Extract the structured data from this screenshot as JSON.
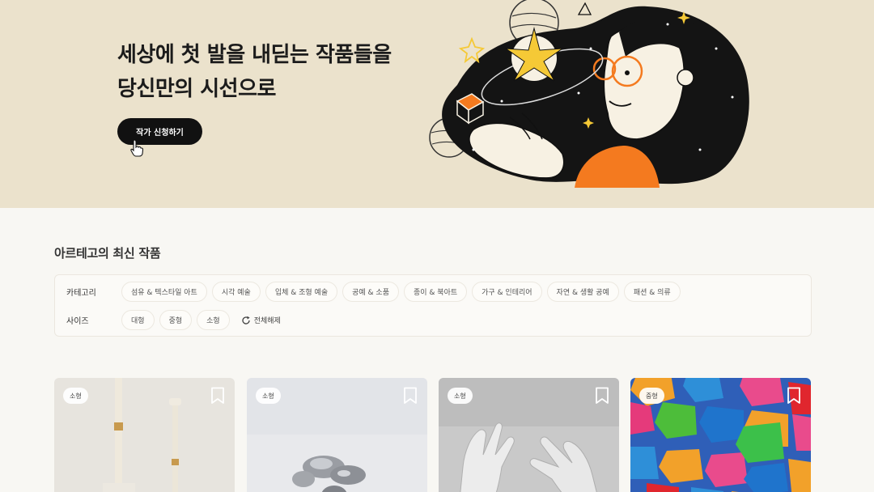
{
  "hero": {
    "title_line1": "세상에 첫 발을 내딛는 작품들을",
    "title_line2": "당신만의 시선으로",
    "apply_button": "작가 신청하기",
    "background": "#ebe2cc"
  },
  "section": {
    "title": "아르테고의 최신 작품"
  },
  "filters": {
    "category_label": "카테고리",
    "categories": [
      "섬유 & 텍스타일 아트",
      "시각 예술",
      "입체 & 조형 예술",
      "공예 & 소품",
      "종이 & 북아트",
      "가구 & 인테리어",
      "자연 & 생활 공예",
      "패션 & 의류"
    ],
    "size_label": "사이즈",
    "sizes": [
      "대형",
      "중형",
      "소형"
    ],
    "reset_label": "전체해제"
  },
  "artworks": [
    {
      "size": "소형",
      "icon": "bookmark-icon"
    },
    {
      "size": "소형",
      "icon": "bookmark-icon"
    },
    {
      "size": "소형",
      "icon": "bookmark-icon"
    },
    {
      "size": "중형",
      "icon": "bookmark-icon"
    }
  ],
  "colors": {
    "accent_orange": "#f47a1f",
    "button_dark": "#111111",
    "star_yellow": "#f5c936"
  }
}
